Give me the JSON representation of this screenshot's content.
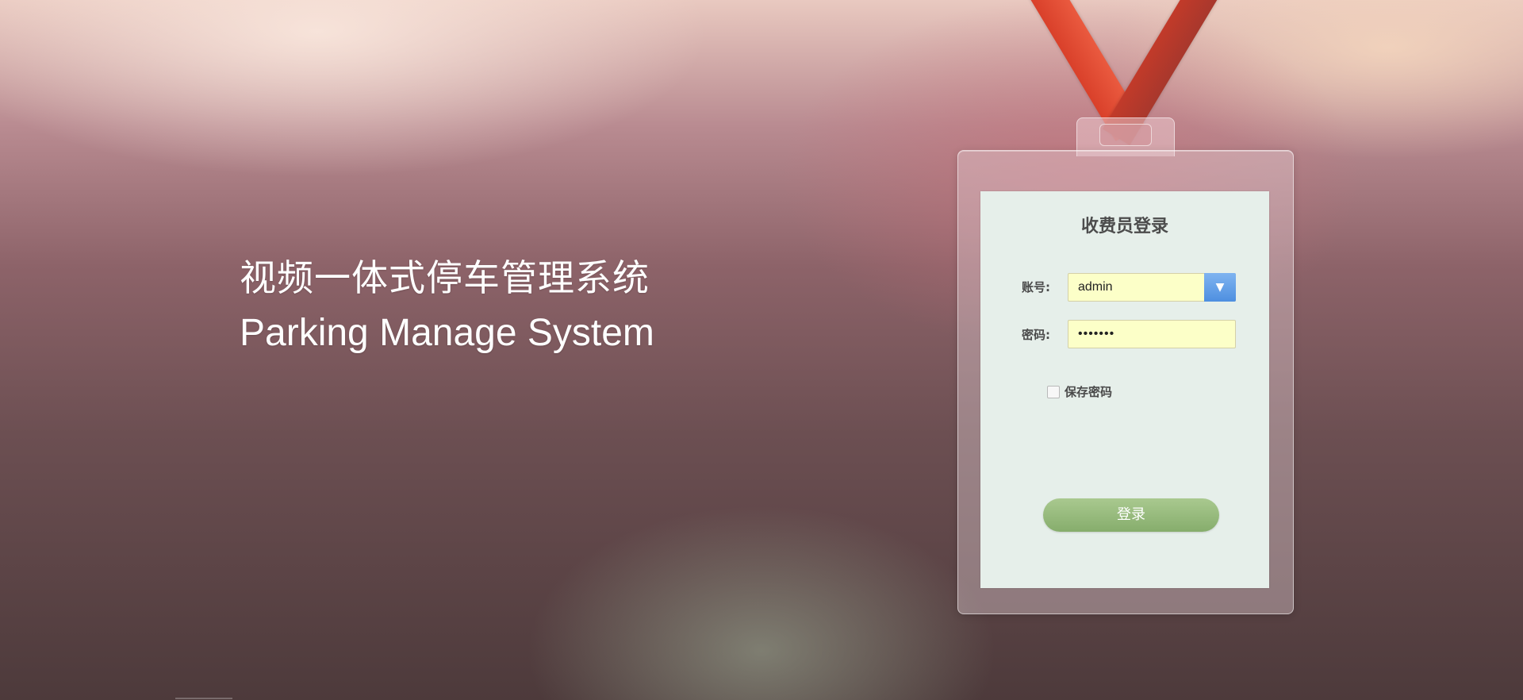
{
  "headline": {
    "title_cn": "视频一体式停车管理系统",
    "title_en": "Parking Manage System"
  },
  "login_card": {
    "title": "收费员登录",
    "account_label": "账号:",
    "account_value": "admin",
    "password_label": "密码:",
    "password_value": "•••••••",
    "dropdown_glyph": "▼",
    "remember_label": "保存密码",
    "remember_checked": false,
    "login_button": "登录"
  },
  "colors": {
    "lanyard": "#d9402a",
    "card_background": "#e6efea",
    "input_background": "#fcffc8",
    "dropdown_accent": "#4e8fe0",
    "login_button": "#98bb7e"
  },
  "icons": {
    "dropdown": "chevron-down-icon",
    "checkbox": "checkbox-icon"
  }
}
